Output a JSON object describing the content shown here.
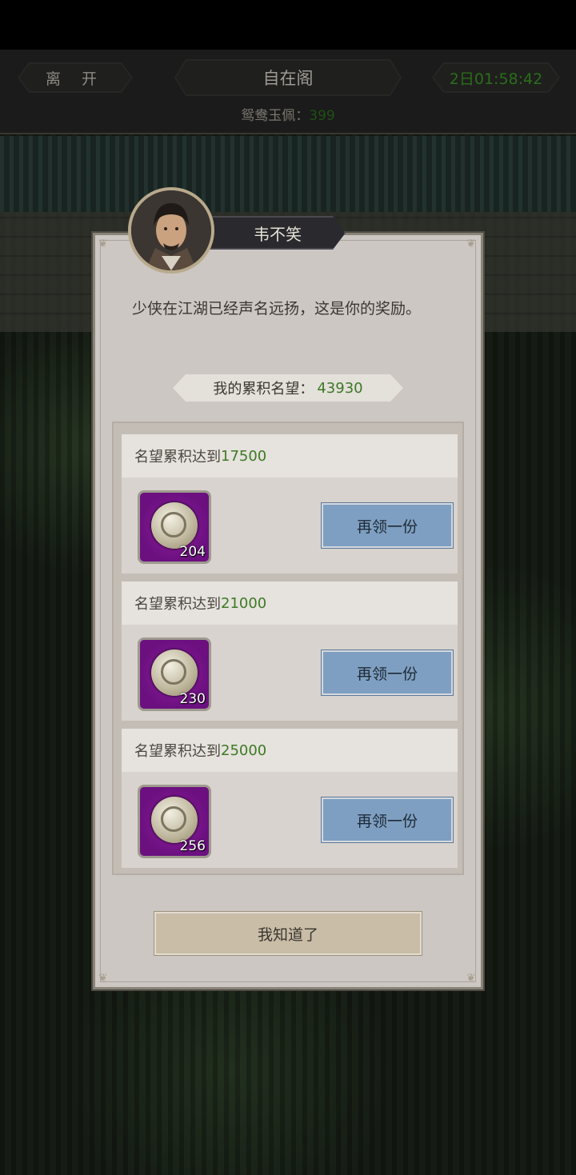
{
  "header": {
    "leave_label": "离 开",
    "title": "自在阁",
    "timer": "2日01:58:42",
    "currency_label": "鸳鸯玉佩：",
    "currency_value": "399"
  },
  "dialog": {
    "npc_name": "韦不笑",
    "message": "少侠在江湖已经声名远扬，这是你的奖励。",
    "fame_label": "我的累积名望：",
    "fame_value": "43930",
    "rewards": [
      {
        "label": "名望累积达到",
        "threshold": "17500",
        "item_icon": "jade-pendant-icon",
        "quantity": "204",
        "button": "再领一份"
      },
      {
        "label": "名望累积达到",
        "threshold": "21000",
        "item_icon": "jade-pendant-icon",
        "quantity": "230",
        "button": "再领一份"
      },
      {
        "label": "名望累积达到",
        "threshold": "25000",
        "item_icon": "jade-pendant-icon",
        "quantity": "256",
        "button": "再领一份"
      }
    ],
    "confirm_label": "我知道了"
  },
  "colors": {
    "accent_green": "#3c7a25",
    "button_blue": "#7e9fc1",
    "item_purple": "#8f1f9e"
  }
}
